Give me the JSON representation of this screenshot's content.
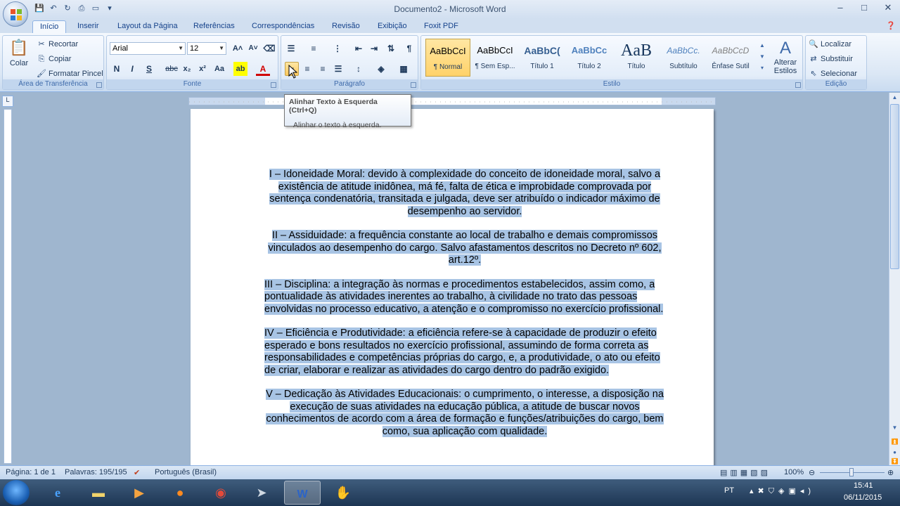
{
  "window": {
    "title": "Documento2 - Microsoft Word",
    "controls": [
      "–",
      "□",
      "✕"
    ]
  },
  "quick_access": [
    "save-icon",
    "undo-icon",
    "redo-icon",
    "print-preview-icon",
    "new-doc-icon"
  ],
  "tabs": [
    "Início",
    "Inserir",
    "Layout da Página",
    "Referências",
    "Correspondências",
    "Revisão",
    "Exibição",
    "Foxit PDF"
  ],
  "active_tab": "Início",
  "clipboard": {
    "paste": "Colar",
    "cut": "Recortar",
    "copy": "Copiar",
    "format_painter": "Formatar Pincel",
    "label": "Área de Transferência"
  },
  "font": {
    "family": "Arial",
    "size": "12",
    "bold": "N",
    "italic": "I",
    "underline": "S",
    "strike": "abc",
    "subscript": "x₂",
    "superscript": "x²",
    "case": "Aa",
    "label": "Fonte"
  },
  "paragraph": {
    "label": "Parágrafo"
  },
  "styles": {
    "label": "Estilo",
    "items": [
      {
        "preview": "AaBbCcI",
        "name": "¶ Normal"
      },
      {
        "preview": "AaBbCcI",
        "name": "¶ Sem Esp..."
      },
      {
        "preview": "AaBbC(",
        "name": "Título 1"
      },
      {
        "preview": "AaBbCc",
        "name": "Título 2"
      },
      {
        "preview": "AaB",
        "name": "Título"
      },
      {
        "preview": "AaBbCc.",
        "name": "Subtítulo"
      },
      {
        "preview": "AaBbCcD",
        "name": "Ênfase Sutil"
      }
    ],
    "change": "Alterar Estilos"
  },
  "editing": {
    "find": "Localizar",
    "replace": "Substituir",
    "select": "Selecionar",
    "label": "Edição"
  },
  "tooltip": {
    "title": "Alinhar Texto à Esquerda (Ctrl+Q)",
    "desc": "Alinhar o texto à esquerda."
  },
  "document": {
    "p1": "I – Idoneidade Moral: devido à complexidade do conceito de idoneidade moral, salvo a existência de atitude inidônea, má fé, falta de ética e improbidade comprovada por sentença condenatória, transitada e julgada, deve ser atribuído o indicador máximo de desempenho ao servidor.",
    "p2": "II – Assiduidade: a frequência constante ao local de trabalho e demais compromissos vinculados ao desempenho do cargo. Salvo afastamentos descritos no Decreto nº 602, art.12º.",
    "p3": "III – Disciplina: a integração às normas e procedimentos estabelecidos, assim como, a pontualidade às atividades inerentes ao trabalho, à civilidade no trato das pessoas envolvidas no processo educativo, a atenção e o compromisso no exercício profissional.",
    "p4": "IV – Eficiência e Produtividade: a eficiência refere-se à capacidade de produzir o efeito esperado e bons resultados no exercício profissional, assumindo de forma correta as responsabilidades e competências próprias do cargo, e, a produtividade, o ato ou efeito de criar, elaborar e realizar as atividades do cargo dentro do padrão exigido.",
    "p5": "V – Dedicação às Atividades Educacionais: o cumprimento, o interesse, a disposição na execução de suas atividades na educação pública, a atitude de buscar novos conhecimentos de acordo com a área de formação e funções/atribuições do cargo, bem como, sua aplicação com qualidade."
  },
  "status": {
    "page": "Página: 1 de 1",
    "words": "Palavras: 195/195",
    "language": "Português (Brasil)",
    "zoom": "100%"
  },
  "taskbar": {
    "lang": "PT",
    "time": "15:41",
    "date": "06/11/2015"
  }
}
